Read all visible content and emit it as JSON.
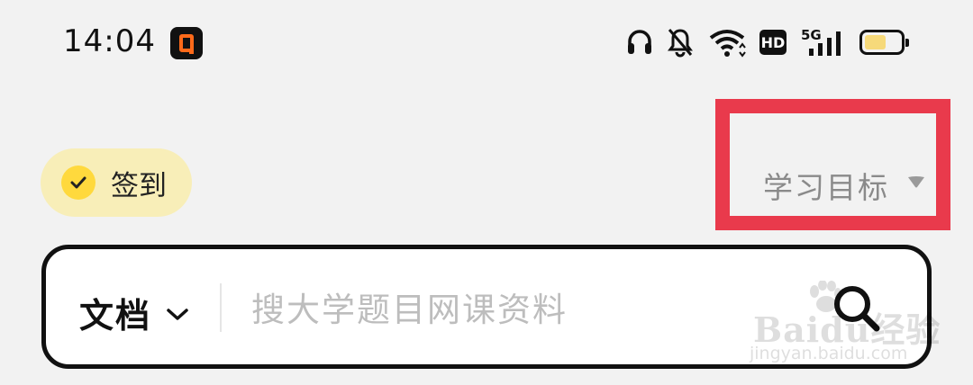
{
  "status_bar": {
    "time": "14:04",
    "app_icon": "orange-frame-app-icon",
    "icons": [
      "headset-icon",
      "bell-off-icon",
      "wifi-icon"
    ],
    "hd": "HD",
    "network": "5G",
    "battery_level": 0.6
  },
  "header": {
    "checkin_label": "签到",
    "goal_label": "学习目标"
  },
  "search": {
    "scope_label": "文档",
    "placeholder": "搜大学题目网课资料"
  },
  "watermark": {
    "brand": "Baidu经验",
    "url": "jingyan.baidu.com"
  },
  "colors": {
    "background": "#f2f2f2",
    "checkin_bg": "#f8eeb8",
    "check_circle": "#ffd93d",
    "highlight": "#e93a4c",
    "app_badge_accent": "#ff6a1a",
    "battery_fill": "#f6d97a"
  }
}
